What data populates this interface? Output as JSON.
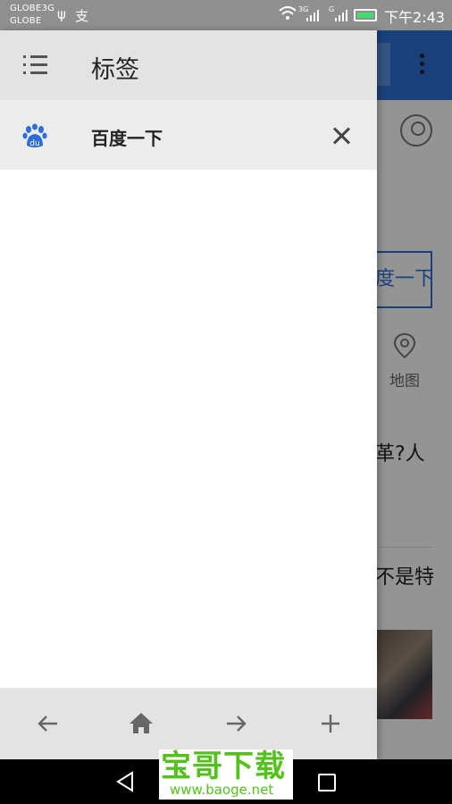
{
  "status_bar": {
    "carrier_line1": "GLOBE3G",
    "carrier_line2": "GLOBE",
    "usb_glyph": "ψ",
    "misc_glyph": "支",
    "signal1_label": "3G",
    "signal2_label": "G",
    "time": "下午2:43",
    "battery_color": "#3ee06b"
  },
  "drawer": {
    "title": "标签",
    "menu_icon": "list-icon",
    "bookmarks": [
      {
        "icon": "baidu-icon",
        "title": "百度一下",
        "close_icon": "close-icon"
      }
    ],
    "toolbar": {
      "back_icon": "arrow-left-icon",
      "home_icon": "home-icon",
      "forward_icon": "arrow-right-icon",
      "add_icon": "plus-icon"
    }
  },
  "background_page": {
    "search_button_label": "度一下",
    "map_label": "地图",
    "news_1": "革?人",
    "news_2": "不是特",
    "accent_color": "#2d6fd6"
  },
  "watermark": {
    "text_cn": "宝哥下载",
    "url": "www.baoge.net",
    "color": "#54c21c"
  }
}
